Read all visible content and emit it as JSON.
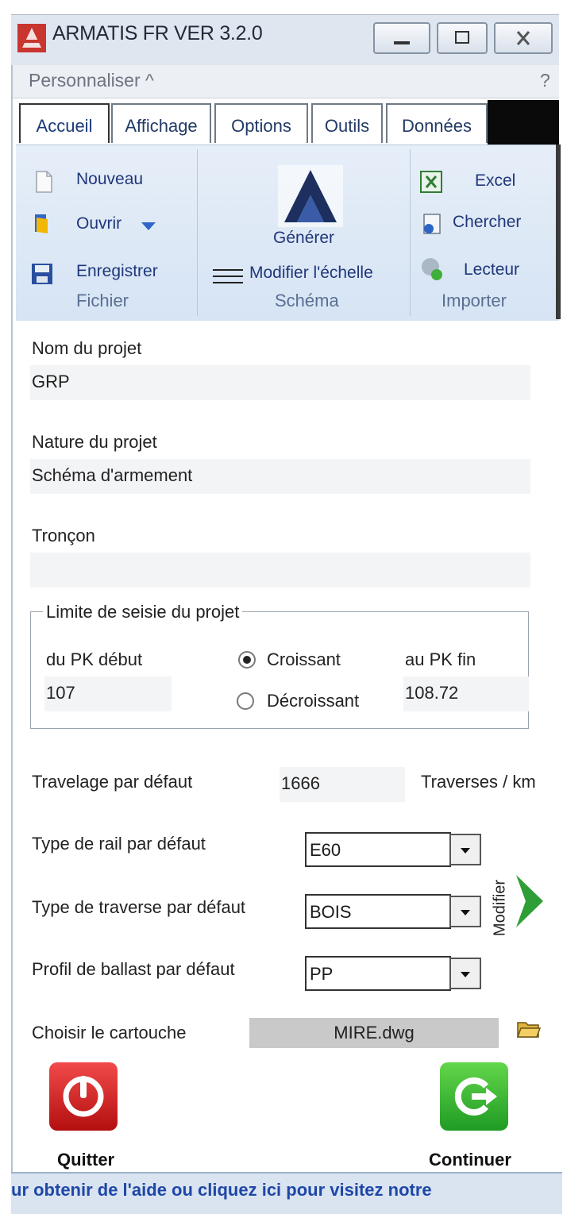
{
  "window": {
    "title": "ARMATIS FR VER 3.2.0",
    "menu_customize": "Personnaliser  ^",
    "help": "?"
  },
  "tabs": [
    "Accueil",
    "Affichage",
    "Options",
    "Outils",
    "Données"
  ],
  "ribbon": {
    "fichier": {
      "nouveau": "Nouveau",
      "ouvrir": "Ouvrir",
      "enregistrer": "Enregistrer",
      "group": "Fichier"
    },
    "schema": {
      "generer": "Générer",
      "modifier_echelle": "Modifier l'échelle",
      "group": "Schéma"
    },
    "importer": {
      "excel": "Excel",
      "chercher": "Chercher",
      "lecteur": "Lecteur",
      "group": "Importer"
    }
  },
  "form": {
    "nom_label": "Nom du projet",
    "nom_value": "GRP",
    "nature_label": "Nature du projet",
    "nature_value": "Schéma d'armement",
    "troncon_label": "Tronçon",
    "troncon_value": "",
    "limite_title": "Limite de seisie du projet",
    "pk_debut_label": "du PK début",
    "pk_debut_value": "107",
    "croissant_label": "Croissant",
    "decroissant_label": "Décroissant",
    "direction_selected": "Croissant",
    "pk_fin_label": "au PK fin",
    "pk_fin_value": "108.72",
    "travelage_label": "Travelage par défaut",
    "travelage_value": "1666",
    "travelage_unit": "Traverses / km",
    "rail_label": "Type de rail par défaut",
    "rail_value": "E60",
    "traverse_label": "Type de traverse par défaut",
    "traverse_value": "BOIS",
    "ballast_label": "Profil de ballast par défaut",
    "ballast_value": "PP",
    "modifier_label": "Modifier",
    "cartouche_label": "Choisir le cartouche",
    "cartouche_value": "MIRE.dwg"
  },
  "actions": {
    "quitter": "Quitter",
    "continuer": "Continuer"
  },
  "status": {
    "text": "ur obtenir de l'aide ou cliquez ici pour visitez notre"
  },
  "colors": {
    "ribbon": "#d6e4f4",
    "link_text": "#20377a",
    "quit": "#d0191b",
    "continue": "#38b833",
    "status_text": "#1f47a8"
  }
}
